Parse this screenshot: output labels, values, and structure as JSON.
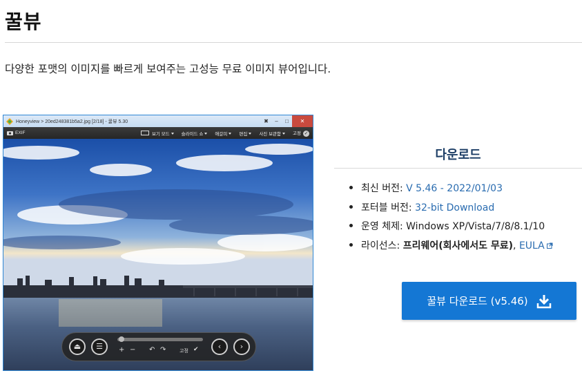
{
  "page": {
    "title": "꿀뷰",
    "tagline": "다양한 포맷의 이미지를 빠르게 보여주는 고성능 무료 이미지 뷰어입니다."
  },
  "screenshot": {
    "window_title": "Honeyview > 20ed248381b5a2.jpg [2/18] - 꿀뷰 5.30",
    "toolbar": {
      "exif": "EXIF",
      "items": [
        "보기 모드",
        "슬라이드 쇼",
        "애갈피",
        "편집",
        "사진 보관함",
        "고정"
      ]
    },
    "controls": {
      "lock_label": "고정"
    }
  },
  "download": {
    "heading": "다운로드",
    "items": [
      {
        "label": "최신 버전: ",
        "value": "V 5.46 - 2022/01/03"
      },
      {
        "label": "포터블 버전: ",
        "value": "32-bit Download"
      },
      {
        "label": "운영 체제: ",
        "value": "Windows XP/Vista/7/8/8.1/10"
      },
      {
        "label": "라이선스: ",
        "value": "프리웨어(회사에서도 무료)",
        "sep": ", ",
        "link": "EULA"
      }
    ],
    "button_label": "꿀뷰 다운로드 (v5.46)"
  },
  "colors": {
    "accent": "#1477d4",
    "link": "#2a6cb0",
    "heading": "#1d3e66",
    "window_border": "#2e86d4"
  }
}
